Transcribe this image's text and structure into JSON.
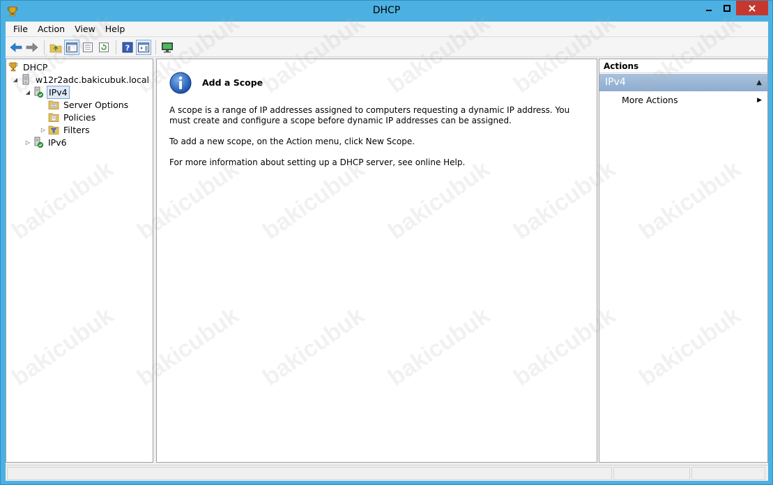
{
  "window": {
    "title": "DHCP"
  },
  "menu": [
    "File",
    "Action",
    "View",
    "Help"
  ],
  "toolbar": {
    "buttons": [
      "back-icon",
      "forward-icon",
      "up-folder-icon",
      "show-hide-tree-icon",
      "export-list-icon",
      "refresh-icon",
      "help-icon",
      "show-hide-action-pane-icon",
      "monitor-icon"
    ]
  },
  "tree": {
    "root": "DHCP",
    "server": "w12r2adc.bakicubuk.local",
    "ipv4": "IPv4",
    "server_options": "Server Options",
    "policies": "Policies",
    "filters": "Filters",
    "ipv6": "IPv6"
  },
  "content": {
    "title": "Add a Scope",
    "para1": "A scope is a range of IP addresses assigned to computers requesting a dynamic IP address. You must create and configure a scope before dynamic IP addresses can be assigned.",
    "para2": "To add a new scope, on the Action menu, click New Scope.",
    "para3": "For more information about setting up a DHCP server, see online Help."
  },
  "actions": {
    "header": "Actions",
    "section": "IPv4",
    "item": "More Actions"
  },
  "watermark": "bakicubuk",
  "colors": {
    "window_frame": "#4cb1e2",
    "close_button": "#c7372e",
    "actions_section": "#8eacd0",
    "selection": "#dfeaf8"
  }
}
